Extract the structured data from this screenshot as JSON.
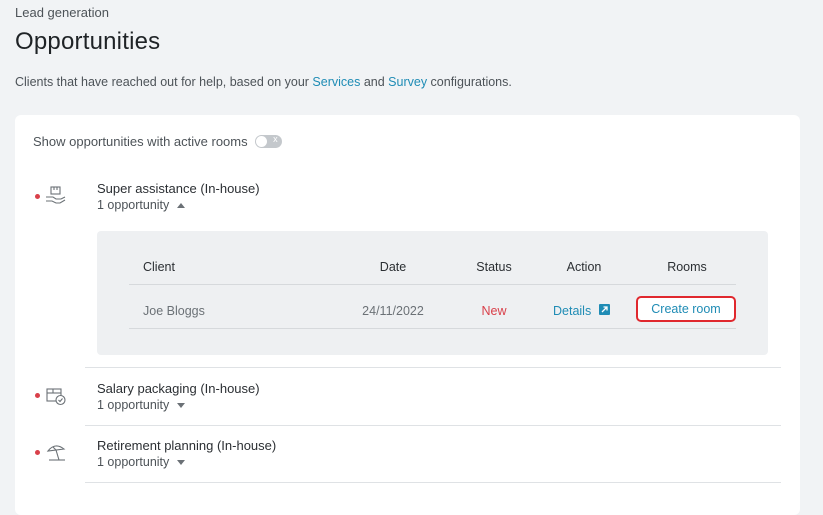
{
  "header": {
    "breadcrumb": "Lead generation",
    "title": "Opportunities",
    "subtitle_pre": "Clients that have reached out for help, based on your ",
    "subtitle_link1": "Services",
    "subtitle_mid": " and ",
    "subtitle_link2": "Survey",
    "subtitle_post": " configurations."
  },
  "filter": {
    "toggle_label": "Show opportunities with active rooms",
    "toggle_state": "off",
    "toggle_glyph": "x"
  },
  "services": [
    {
      "name": "Super assistance (In-house)",
      "count": "1 opportunity",
      "expanded": true,
      "icon": "hand-box-icon"
    },
    {
      "name": "Salary packaging (In-house)",
      "count": "1 opportunity",
      "expanded": false,
      "icon": "box-check-icon"
    },
    {
      "name": "Retirement planning (In-house)",
      "count": "1 opportunity",
      "expanded": false,
      "icon": "beach-umbrella-icon"
    }
  ],
  "table": {
    "columns": [
      "Client",
      "Date",
      "Status",
      "Action",
      "Rooms"
    ],
    "rows": [
      {
        "client": "Joe Bloggs",
        "date": "24/11/2022",
        "status": "New",
        "action": "Details",
        "rooms": "Create room"
      }
    ]
  },
  "colors": {
    "accent": "#1f8cb5",
    "status_new": "#d9404a",
    "highlight": "#e0282e"
  }
}
